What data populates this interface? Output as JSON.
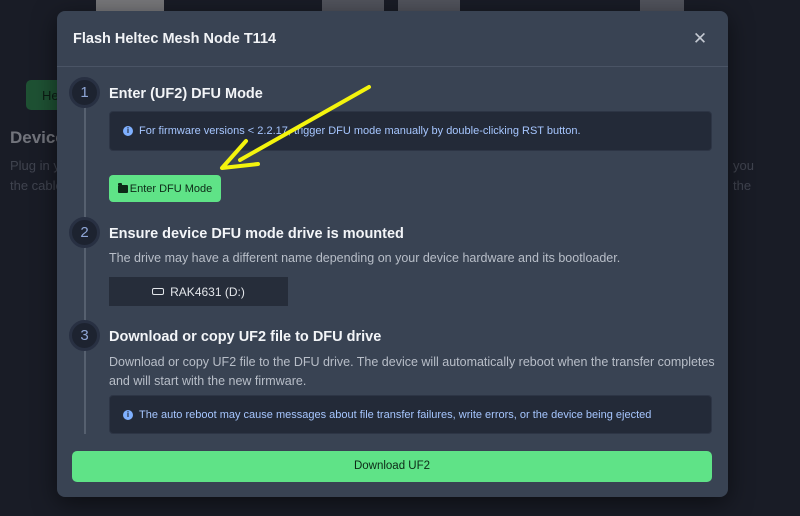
{
  "background": {
    "button_label": "Helt",
    "heading": "Device",
    "left_lines": [
      "Plug in y",
      "the cable"
    ],
    "right_lines": [
      "you",
      "the"
    ]
  },
  "modal": {
    "title": "Flash Heltec Mesh Node T114",
    "close_glyph": "✕",
    "steps": [
      {
        "number": "1",
        "title": "Enter (UF2) DFU Mode",
        "alert": "For firmware versions < 2.2.17, trigger DFU mode manually by double-clicking RST button.",
        "button_label": "Enter DFU Mode"
      },
      {
        "number": "2",
        "title": "Ensure device DFU mode drive is mounted",
        "description": "The drive may have a different name depending on your device hardware and its bootloader.",
        "drive_label": "RAK4631 (D:)"
      },
      {
        "number": "3",
        "title": "Download or copy UF2 file to DFU drive",
        "description": "Download or copy UF2 file to the DFU drive. The device will automatically reboot when the transfer completes and will start with the new firmware.",
        "alert": "The auto reboot may cause messages about file transfer failures, write errors, or the device being ejected"
      }
    ],
    "download_button": "Download UF2"
  },
  "icons": {
    "info": "info-icon",
    "folder": "folder-icon",
    "drive": "drive-icon",
    "close": "close-icon"
  },
  "colors": {
    "accent_green": "#5fe387",
    "modal_bg": "#394353",
    "annotation_arrow": "#f4f40d"
  }
}
